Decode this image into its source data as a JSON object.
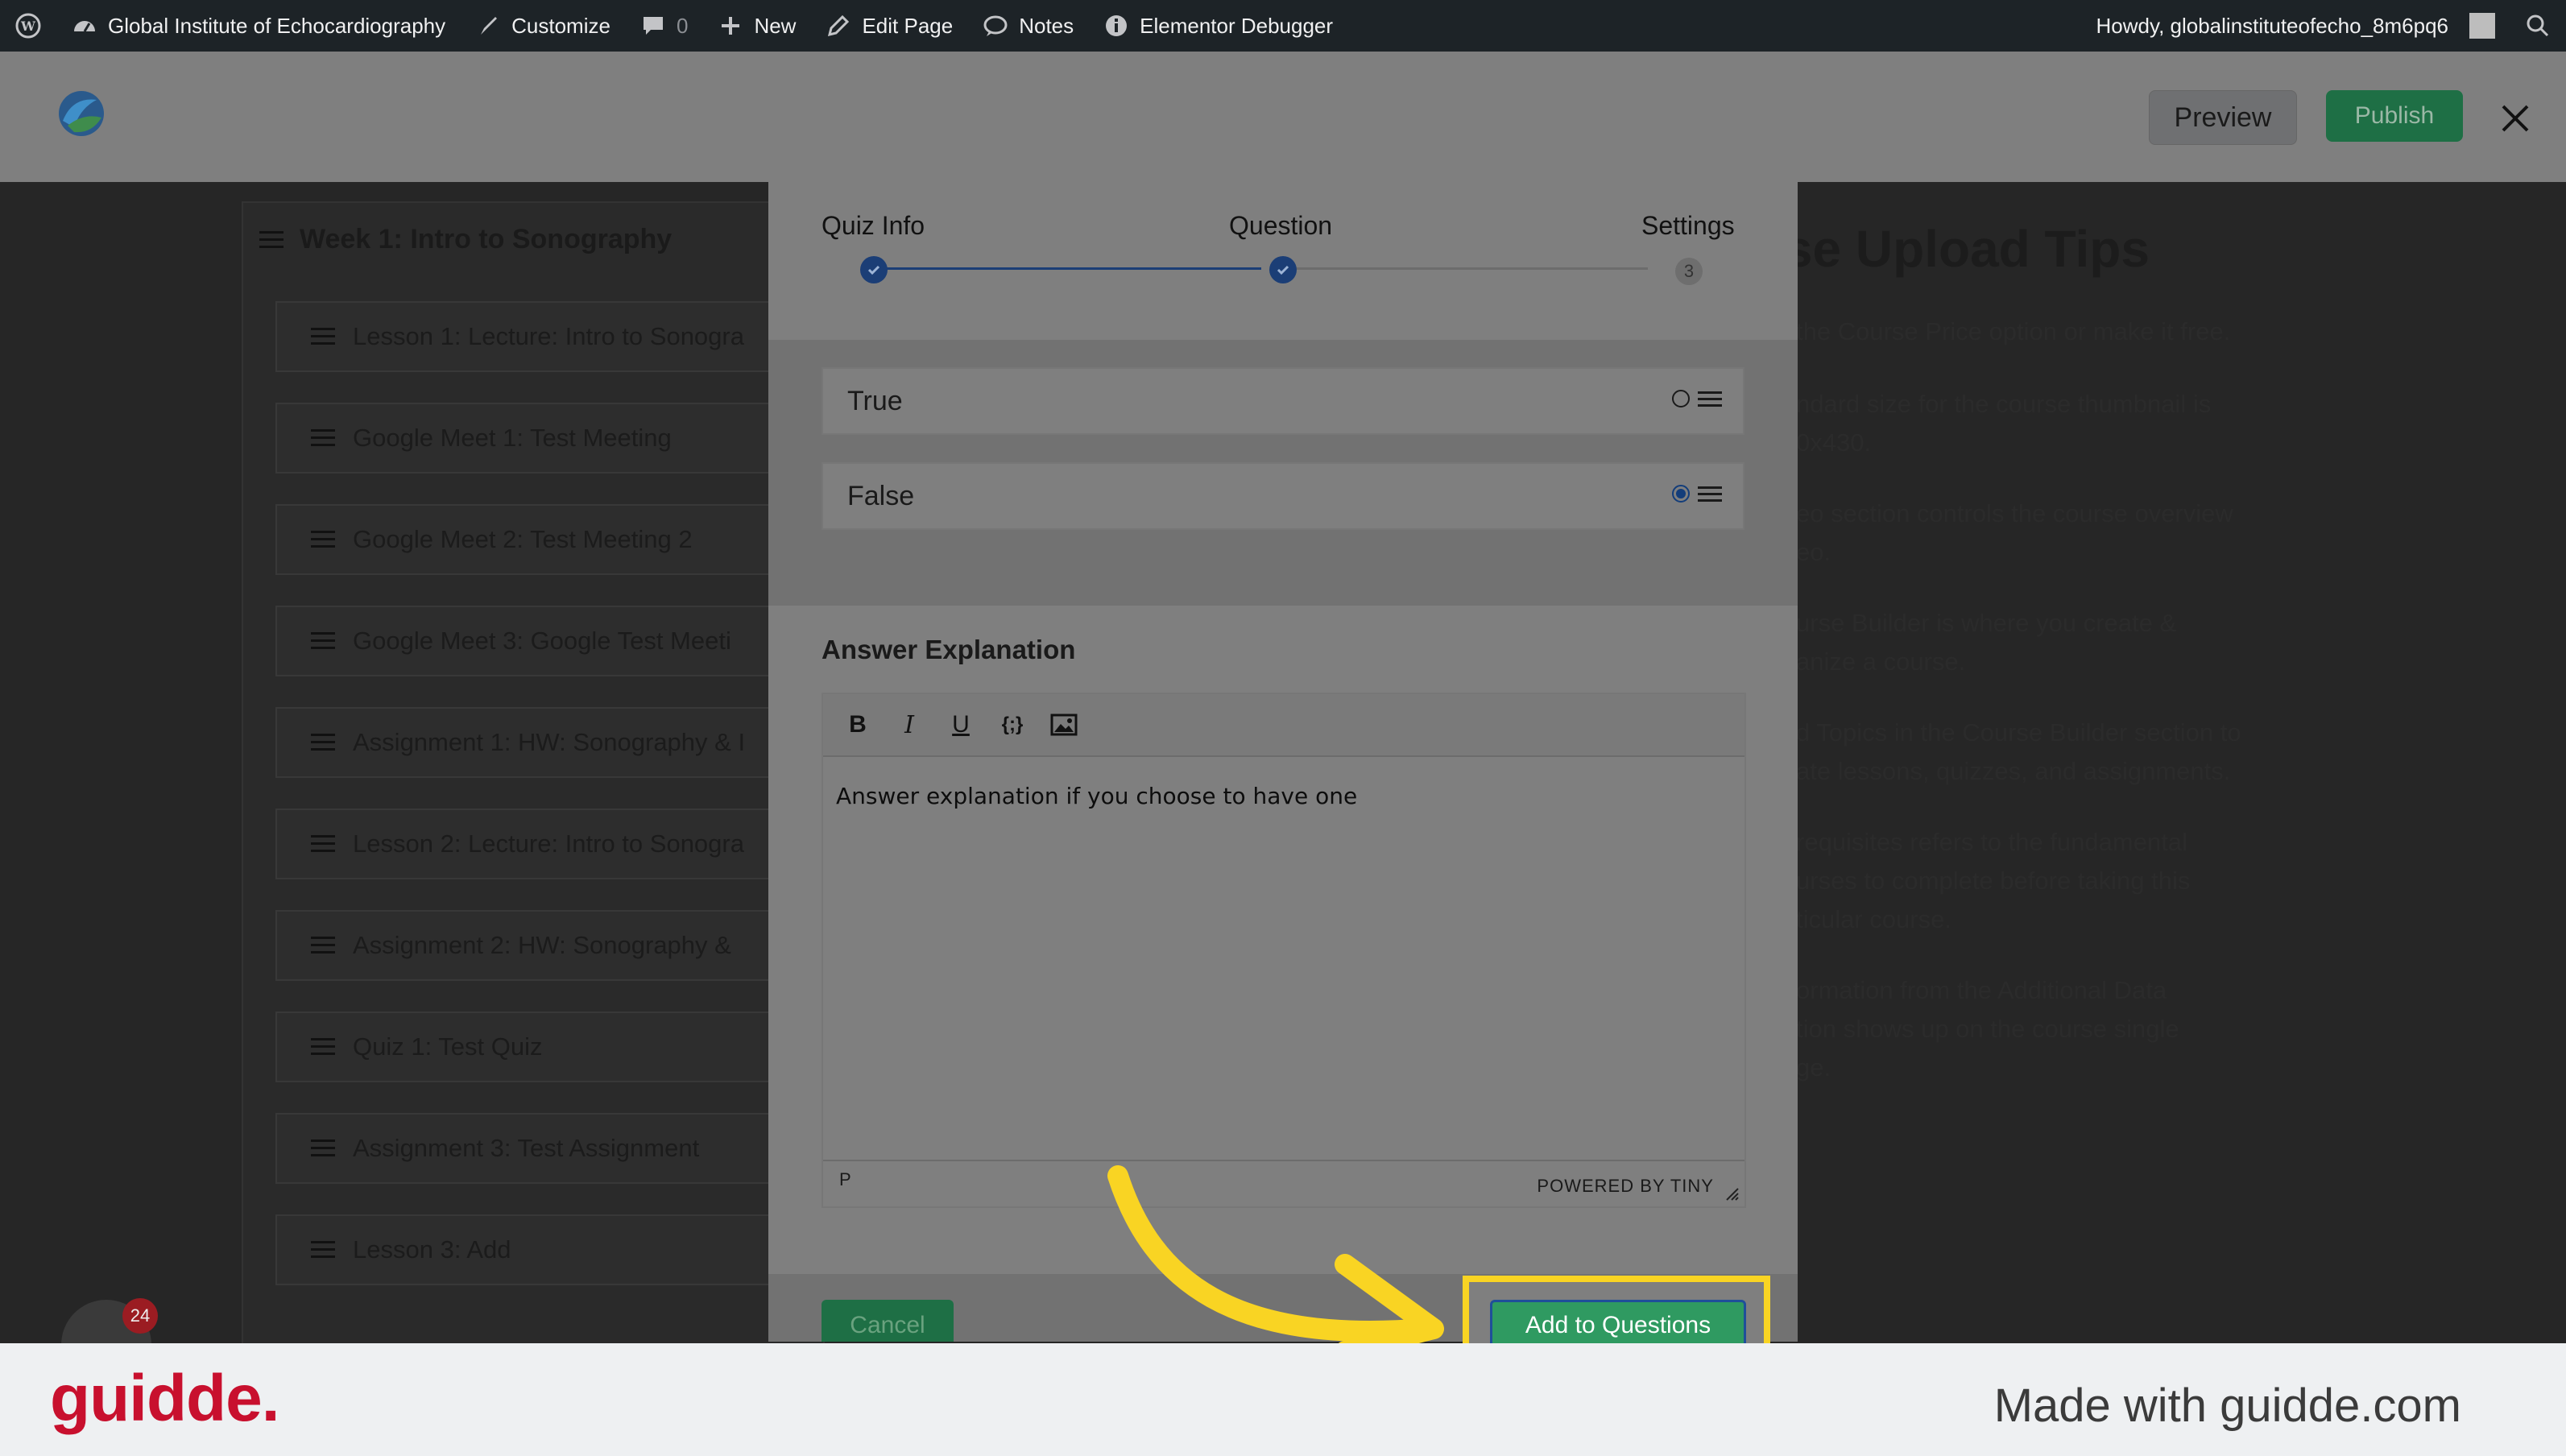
{
  "admin_bar": {
    "site_name": "Global Institute of Echocardiography",
    "customize": "Customize",
    "comments_count": "0",
    "new": "New",
    "edit_page": "Edit Page",
    "notes": "Notes",
    "elementor_debugger": "Elementor Debugger",
    "howdy": "Howdy, globalinstituteofecho_8m6pq6"
  },
  "header": {
    "preview_label": "Preview",
    "publish_label": "Publish"
  },
  "topic": {
    "title": "Week 1: Intro to Sonography",
    "items": [
      "Lesson 1: Lecture: Intro to Sonogra",
      "Google Meet 1: Test Meeting",
      "Google Meet 2: Test Meeting 2",
      "Google Meet 3: Google Test Meeti",
      "Assignment 1: HW: Sonography & I",
      "Lesson 2: Lecture: Intro to Sonogra",
      "Assignment 2: HW: Sonography &",
      "Quiz 1: Test Quiz",
      "Assignment 3: Test Assignment",
      "Lesson 3: Add"
    ]
  },
  "tips": {
    "title": "rse Upload Tips",
    "items": [
      "the Course Price option or make it free.",
      "ndard size for the course thumbnail is\n0x430.",
      "eo section controls the course overview\neo.",
      "urse Builder is where you create &\nanize a course.",
      "d Topics in the Course Builder section to\nate lessons, quizzes, and assignments.",
      "requisites refers to the fundamental\nurses to complete before taking this\nticular course.",
      "ormation from the Additional Data\ntion shows up on the course single\nge."
    ]
  },
  "modal": {
    "steps": [
      {
        "label": "Quiz Info",
        "state": "done"
      },
      {
        "label": "Question",
        "state": "done"
      },
      {
        "label": "Settings",
        "state": "pending",
        "number": "3"
      }
    ],
    "answers": [
      {
        "text": "True",
        "selected": false
      },
      {
        "text": "False",
        "selected": true
      }
    ],
    "explanation_label": "Answer Explanation",
    "editor_text": "Answer explanation if you choose to have one",
    "status_path": "P",
    "powered_by": "POWERED BY TINY",
    "cancel_label": "Cancel",
    "add_label": "Add to Questions"
  },
  "widget_badge": "24",
  "footer": {
    "brand": "guidde.",
    "made_with": "Made with guidde.com"
  },
  "colors": {
    "highlight": "#f9d423",
    "accent_blue": "#1b3e76",
    "green": "#2f9a61",
    "brand_red": "#c8102e"
  }
}
